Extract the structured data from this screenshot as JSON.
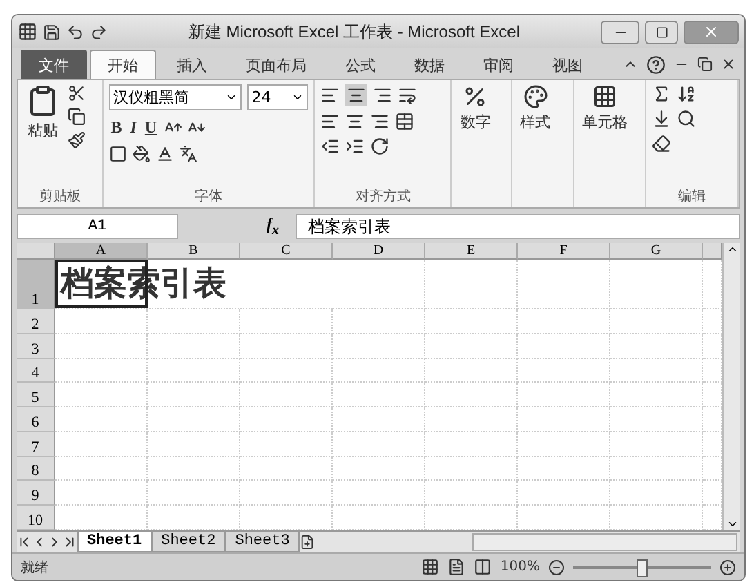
{
  "window": {
    "title": "新建 Microsoft Excel 工作表 - Microsoft Excel"
  },
  "tabs": [
    {
      "label": "文件",
      "kind": "file",
      "selected": false
    },
    {
      "label": "开始",
      "kind": "tab",
      "selected": true
    },
    {
      "label": "插入",
      "kind": "tab",
      "selected": false
    },
    {
      "label": "页面布局",
      "kind": "tab",
      "selected": false
    },
    {
      "label": "公式",
      "kind": "tab",
      "selected": false
    },
    {
      "label": "数据",
      "kind": "tab",
      "selected": false
    },
    {
      "label": "审阅",
      "kind": "tab",
      "selected": false
    },
    {
      "label": "视图",
      "kind": "tab",
      "selected": false
    }
  ],
  "ribbon": {
    "clipboard": {
      "paste": "粘贴",
      "label": "剪贴板"
    },
    "font": {
      "font_name": "汉仪粗黑简",
      "font_size": "24",
      "bold": "B",
      "italic": "I",
      "underline": "U",
      "label": "字体"
    },
    "alignment": {
      "label": "对齐方式"
    },
    "number": {
      "button": "数字"
    },
    "styles": {
      "button": "样式"
    },
    "cells": {
      "button": "单元格"
    },
    "editing": {
      "label": "编辑"
    }
  },
  "formula_bar": {
    "name_box": "A1",
    "fx": "f$_{x}$",
    "content": "档案索引表"
  },
  "sheet": {
    "columns": [
      {
        "label": "A",
        "selected": true
      },
      {
        "label": "B",
        "selected": false
      },
      {
        "label": "C",
        "selected": false
      },
      {
        "label": "D",
        "selected": false
      },
      {
        "label": "E",
        "selected": false
      },
      {
        "label": "F",
        "selected": false
      },
      {
        "label": "G",
        "selected": false
      }
    ],
    "rows": [
      {
        "label": "1",
        "selected": true,
        "cells": [
          {
            "value": "档案索引表",
            "selected": true
          }
        ]
      },
      {
        "label": "2",
        "selected": false
      },
      {
        "label": "3",
        "selected": false
      },
      {
        "label": "4",
        "selected": false
      },
      {
        "label": "5",
        "selected": false
      },
      {
        "label": "6",
        "selected": false
      },
      {
        "label": "7",
        "selected": false
      },
      {
        "label": "8",
        "selected": false
      },
      {
        "label": "9",
        "selected": false
      },
      {
        "label": "10",
        "selected": false
      }
    ]
  },
  "sheet_tabs": [
    {
      "label": "Sheet1",
      "selected": true
    },
    {
      "label": "Sheet2",
      "selected": false
    },
    {
      "label": "Sheet3",
      "selected": false
    }
  ],
  "status_bar": {
    "status": "就绪",
    "zoom": "100%",
    "zoom_slider": {
      "level": 0.5
    }
  }
}
